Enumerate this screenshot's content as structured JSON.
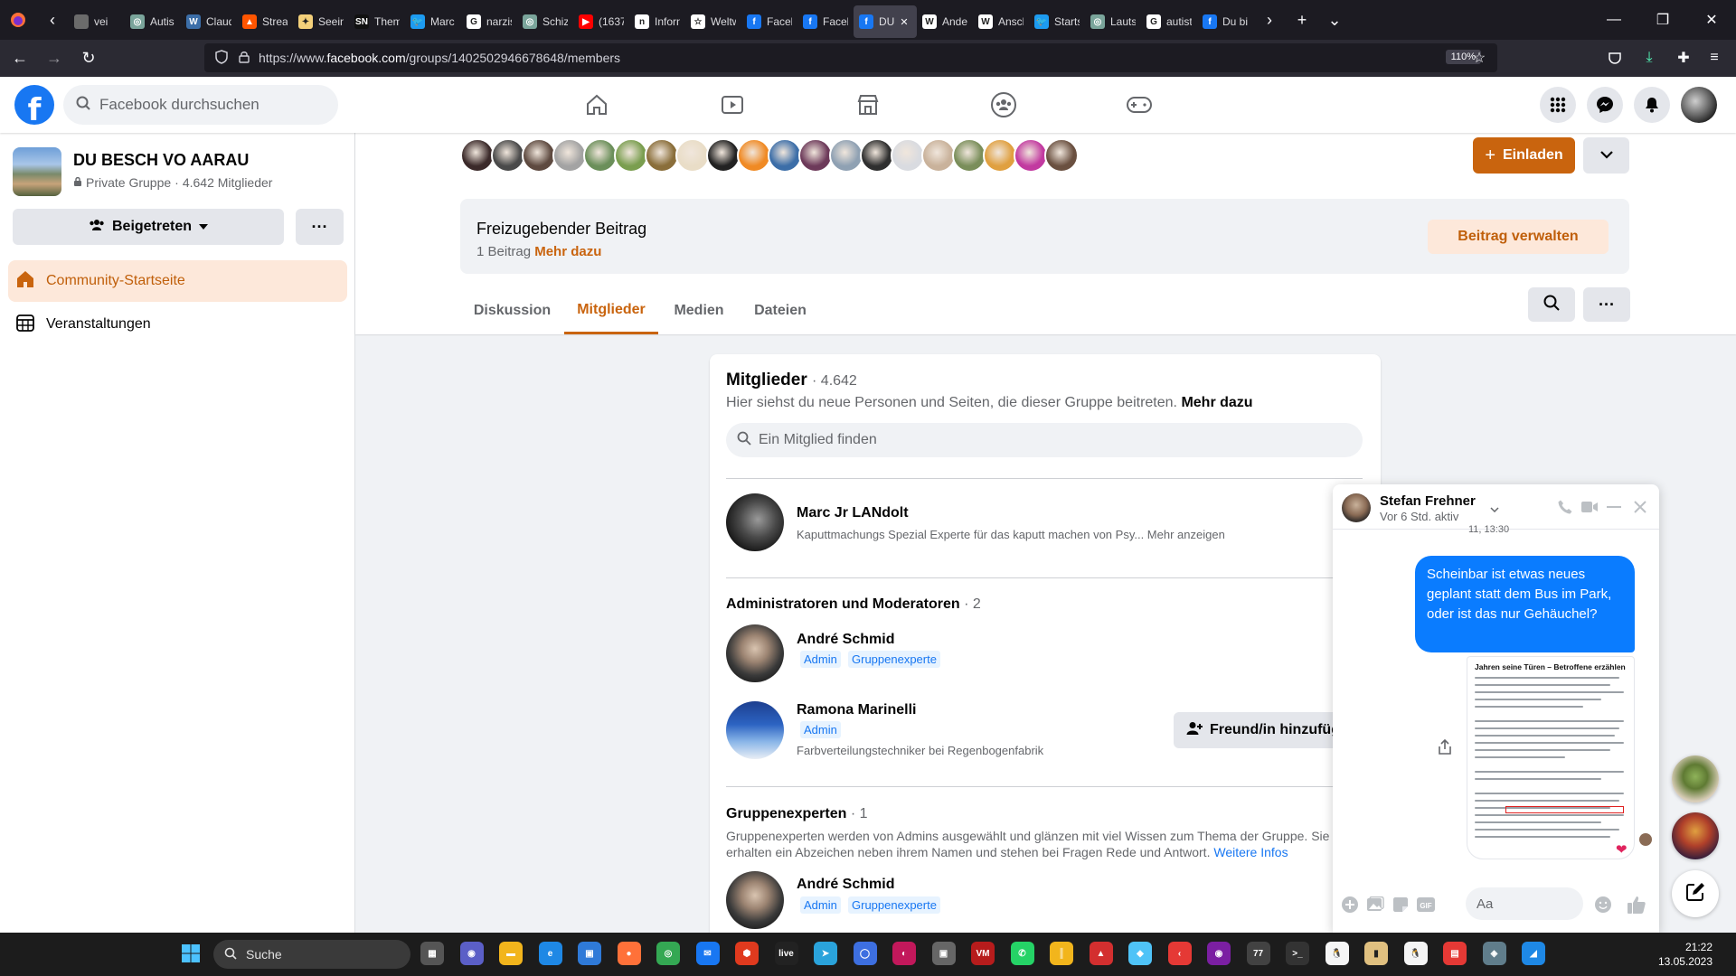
{
  "browser": {
    "tabs": [
      {
        "label": "vei",
        "color": "#6b6b6b",
        "glyph": ""
      },
      {
        "label": "Autis",
        "color": "#7aa59b",
        "glyph": "◎"
      },
      {
        "label": "Claud",
        "color": "#3c6ea8",
        "glyph": "W"
      },
      {
        "label": "Strea",
        "color": "#ff5500",
        "glyph": "▲"
      },
      {
        "label": "Seein",
        "color": "#f3d07a",
        "glyph": "✦"
      },
      {
        "label": "Them",
        "color": "#111111",
        "glyph": "SN"
      },
      {
        "label": "Marc",
        "color": "#1d9bf0",
        "glyph": "🐦"
      },
      {
        "label": "narzis",
        "color": "#ffffff",
        "glyph": "G"
      },
      {
        "label": "Schiz",
        "color": "#7aa59b",
        "glyph": "◎"
      },
      {
        "label": "(1637",
        "color": "#ff0000",
        "glyph": "▶"
      },
      {
        "label": "Inforn",
        "color": "#ffffff",
        "glyph": "n"
      },
      {
        "label": "Weltw",
        "color": "#ffffff",
        "glyph": "☆"
      },
      {
        "label": "Faceb",
        "color": "#1877f2",
        "glyph": "f"
      },
      {
        "label": "Faceb",
        "color": "#1877f2",
        "glyph": "f"
      },
      {
        "label": "DU",
        "color": "#1877f2",
        "glyph": "f"
      },
      {
        "label": "Ander",
        "color": "#ffffff",
        "glyph": "W"
      },
      {
        "label": "Ansch",
        "color": "#ffffff",
        "glyph": "W"
      },
      {
        "label": "Starts",
        "color": "#1d9bf0",
        "glyph": "🐦"
      },
      {
        "label": "Lautst",
        "color": "#7aa59b",
        "glyph": "◎"
      },
      {
        "label": "autist",
        "color": "#ffffff",
        "glyph": "G"
      },
      {
        "label": "Du bi",
        "color": "#1877f2",
        "glyph": "f"
      }
    ],
    "url_prefix": "https://www.",
    "url_host": "facebook.com",
    "url_path": "/groups/1402502946678648/members",
    "zoom": "110%"
  },
  "fb": {
    "search_placeholder": "Facebook durchsuchen"
  },
  "group": {
    "name": "DU BESCH VO AARAU",
    "privacy": "Private Gruppe",
    "members_text": "4.642 Mitglieder",
    "joined_label": "Beigetreten",
    "more_label": "···",
    "invite_label": "Einladen",
    "nav": [
      {
        "label": "Community-Startseite"
      },
      {
        "label": "Veranstaltungen"
      }
    ],
    "avatar_colors": [
      "#3b2a2a",
      "#4a4a4a",
      "#5e4a40",
      "#a3a3a3",
      "#6b8f5a",
      "#7a9e4f",
      "#8a6e3a",
      "#e9ddc7",
      "#222222",
      "#f08a24",
      "#3c6ea8",
      "#6d3a5a",
      "#8fa1b3",
      "#2f2f2f",
      "#d9dbe0",
      "#c9b29b",
      "#7a8e5a",
      "#e0a040",
      "#c23aa0",
      "#6a5040"
    ],
    "free_post_title": "Freizugebender Beitrag",
    "free_post_count": "1 Beitrag",
    "free_post_link": "Mehr dazu",
    "manage_label": "Beitrag verwalten",
    "tabs": [
      {
        "label": "Diskussion"
      },
      {
        "label": "Mitglieder"
      },
      {
        "label": "Medien"
      },
      {
        "label": "Dateien"
      }
    ]
  },
  "members": {
    "title": "Mitglieder",
    "count": "· 4.642",
    "description": "Hier siehst du neue Personen und Seiten, die dieser Gruppe beitreten.",
    "description_link": "Mehr dazu",
    "search_placeholder": "Ein Mitglied finden",
    "me": {
      "name": "Marc Jr LANdolt",
      "bio": "Kaputtmachungs Spezial Experte für das kaputt machen von Psy... Mehr anzeigen"
    },
    "admins_heading": "Administratoren und Moderatoren",
    "admins_count": "· 2",
    "admins": [
      {
        "name": "André Schmid",
        "badges": [
          "Admin",
          "Gruppenexperte"
        ],
        "bio": ""
      },
      {
        "name": "Ramona Marinelli",
        "badges": [
          "Admin"
        ],
        "bio": "Farbverteilungstechniker bei Regenbogenfabrik"
      }
    ],
    "add_friend_label": "Freund/in hinzufüg",
    "experts_heading": "Gruppenexperten",
    "experts_count": "· 1",
    "experts_desc": "Gruppenexperten werden von Admins ausgewählt und glänzen mit viel Wissen zum Thema der Gruppe. Sie erhalten ein Abzeichen neben ihrem Namen und stehen bei Fragen Rede und Antwort.",
    "experts_link": "Weitere Infos",
    "experts": [
      {
        "name": "André Schmid",
        "badges": [
          "Admin",
          "Gruppenexperte"
        ]
      }
    ]
  },
  "chat": {
    "name": "Stefan Frehner",
    "status": "Vor 6 Std. aktiv",
    "timestamp": "11, 13:30",
    "message": "Scheinbar ist etwas neues geplant statt dem Bus im Park, oder ist das nur Gehäuchel?",
    "image_title": "Jahren seine Türen – Betroffene erzählen",
    "input_placeholder": "Aa"
  },
  "taskbar": {
    "search_label": "Suche",
    "time": "21:22",
    "date": "13.05.2023",
    "apps": [
      {
        "color": "#555555",
        "glyph": "▦"
      },
      {
        "color": "#5b5fc7",
        "glyph": "◉"
      },
      {
        "color": "#f2b51c",
        "glyph": "▬"
      },
      {
        "color": "#1e88e5",
        "glyph": "e"
      },
      {
        "color": "#2f7ad8",
        "glyph": "▣"
      },
      {
        "color": "#ff7139",
        "glyph": "●"
      },
      {
        "color": "#34a853",
        "glyph": "◎"
      },
      {
        "color": "#1877f2",
        "glyph": "✉"
      },
      {
        "color": "#e03a1e",
        "glyph": "⬢"
      },
      {
        "color": "#222222",
        "glyph": "live"
      },
      {
        "color": "#2aa3db",
        "glyph": "➤"
      },
      {
        "color": "#3d6fe0",
        "glyph": "◯"
      },
      {
        "color": "#c2185b",
        "glyph": "◐"
      },
      {
        "color": "#666666",
        "glyph": "▣"
      },
      {
        "color": "#b71c1c",
        "glyph": "VM"
      },
      {
        "color": "#25d366",
        "glyph": "✆"
      },
      {
        "color": "#f2b51c",
        "glyph": "║"
      },
      {
        "color": "#d32f2f",
        "glyph": "▲"
      },
      {
        "color": "#4fc3f7",
        "glyph": "◆"
      },
      {
        "color": "#e53935",
        "glyph": "‹"
      },
      {
        "color": "#7b1fa2",
        "glyph": "◉"
      },
      {
        "color": "#424242",
        "glyph": "77"
      },
      {
        "color": "#333333",
        "glyph": ">_"
      },
      {
        "color": "#f5f5f5",
        "glyph": "🐧"
      },
      {
        "color": "#e0c080",
        "glyph": "▮"
      },
      {
        "color": "#f5f5f5",
        "glyph": "🐧"
      },
      {
        "color": "#e53935",
        "glyph": "▤"
      },
      {
        "color": "#607d8b",
        "glyph": "◈"
      },
      {
        "color": "#1e88e5",
        "glyph": "◢"
      }
    ]
  },
  "colors": {
    "accent": "#c9640e",
    "fb_blue": "#1877f2",
    "messenger_blue": "#0a7cff"
  }
}
